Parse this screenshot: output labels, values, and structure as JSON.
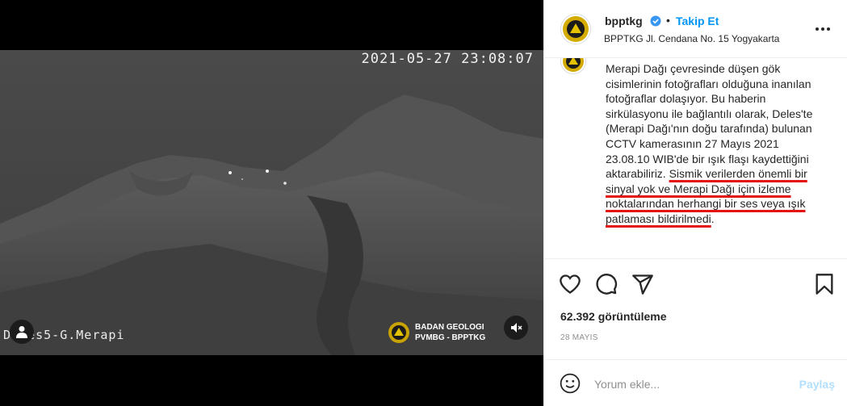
{
  "media": {
    "timestamp": "2021-05-27 23:08:07",
    "camera_label": "Deles5-G.Merapi",
    "brand_line1": "BADAN GEOLOGI",
    "brand_line2": "PVMBG - BPPTKG",
    "mute_icon": "speaker-muted-icon",
    "user_tag_icon": "person-icon"
  },
  "header": {
    "username": "bpptkg",
    "separator": "•",
    "follow_label": "Takip Et",
    "location": "BPPTKG Jl. Cendana No. 15 Yogyakarta",
    "accent": "#0095f6"
  },
  "caption": {
    "plain": "Merapi Dağı çevresinde düşen gök cisimlerinin fotoğrafları olduğuna inanılan fotoğraflar dolaşıyor. Bu haberin sirkülasyonu ile bağlantılı olarak, Deles'te (Merapi Dağı'nın doğu tarafında) bulunan CCTV kamerasının 27 Mayıs 2021 23.08.10 WIB'de bir ışık flaşı kaydettiğini aktarabiliriz. ",
    "highlighted": "Sismik verilerden önemli bir sinyal yok ve Merapi Dağı için izleme noktalarından herhangi bir ses veya ışık patlaması bildirilmedi",
    "end": ".",
    "highlight_color": "#e31313"
  },
  "actions": {
    "like_icon": "heart-icon",
    "comment_icon": "comment-icon",
    "share_icon": "paper-plane-icon",
    "save_icon": "bookmark-icon"
  },
  "stats": {
    "views": "62.392 görüntüleme",
    "date": "28 MAYIS"
  },
  "comment_box": {
    "placeholder": "Yorum ekle...",
    "share_label": "Paylaş",
    "share_color": "#b2dffc"
  }
}
